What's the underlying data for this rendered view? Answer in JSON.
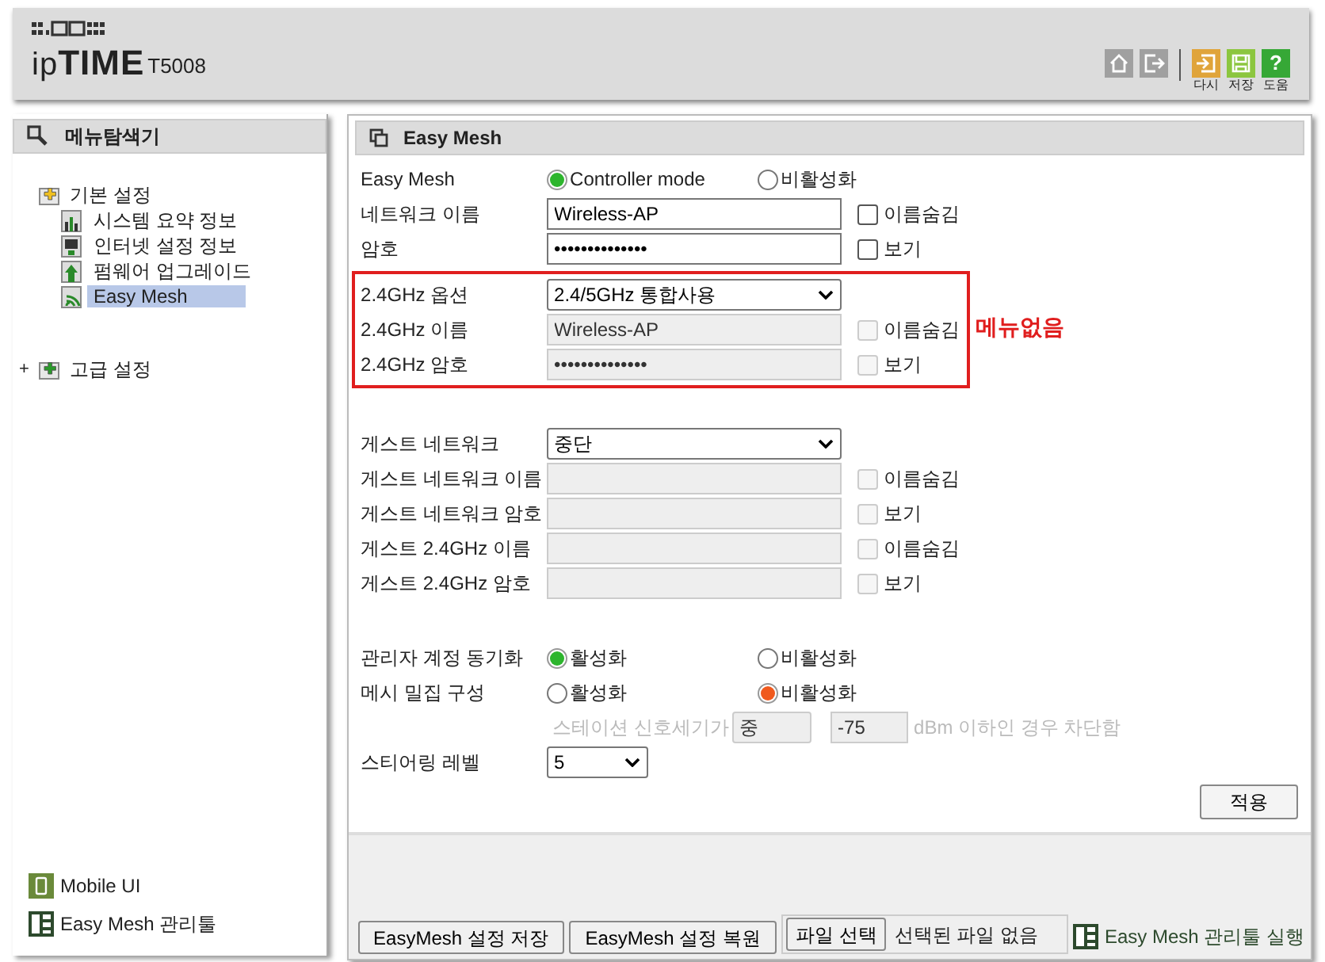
{
  "header": {
    "brand": "ip**TIME**",
    "model": "T5008",
    "tools": [
      {
        "kind": "home"
      },
      {
        "kind": "logout"
      },
      {
        "kind": "reload",
        "label": "다시"
      },
      {
        "kind": "save",
        "label": "저장"
      },
      {
        "kind": "help",
        "label": "도움",
        "glyph": "?"
      }
    ]
  },
  "sidebar": {
    "title": "메뉴탐색기",
    "tree": [
      {
        "label": "기본 설정",
        "children": [
          {
            "label": "시스템 요약 정보",
            "selected": false
          },
          {
            "label": "인터넷 설정 정보",
            "selected": false
          },
          {
            "label": "펌웨어 업그레이드",
            "selected": false
          },
          {
            "label": "Easy Mesh",
            "selected": true
          }
        ]
      },
      {
        "label": "고급 설정",
        "toggle": "+"
      }
    ],
    "links": [
      {
        "label": "Mobile UI"
      },
      {
        "label": "Easy Mesh 관리툴"
      }
    ]
  },
  "panel": {
    "title": "Easy Mesh",
    "sections": [
      {
        "rows": [
          {
            "kind": "radio",
            "label": "Easy Mesh",
            "color": "#2db52d",
            "options": [
              {
                "label": "Controller mode",
                "selected": true
              },
              {
                "label": "비활성화",
                "selected": false
              }
            ]
          },
          {
            "kind": "text",
            "label": "네트워크 이름",
            "value": "Wireless-AP",
            "disabled": false,
            "checkbox": {
              "label": "이름숨김",
              "checked": false,
              "disabled": false
            }
          },
          {
            "kind": "text",
            "label": "암호",
            "value": "••••••••••••••",
            "disabled": false,
            "checkbox": {
              "label": "보기",
              "checked": false,
              "disabled": false
            }
          }
        ]
      },
      {
        "note": "메뉴없음",
        "rows": [
          {
            "kind": "select",
            "label": "2.4GHz 옵션",
            "value": "2.4/5GHz 통합사용",
            "disabled": false
          },
          {
            "kind": "text",
            "label": "2.4GHz 이름",
            "value": "Wireless-AP",
            "disabled": true,
            "checkbox": {
              "label": "이름숨김",
              "checked": false,
              "disabled": true
            }
          },
          {
            "kind": "text",
            "label": "2.4GHz 암호",
            "value": "••••••••••••••",
            "disabled": true,
            "checkbox": {
              "label": "보기",
              "checked": false,
              "disabled": true
            }
          }
        ]
      },
      {
        "rows": [
          {
            "kind": "select",
            "label": "게스트 네트워크",
            "value": "중단",
            "disabled": false
          },
          {
            "kind": "text",
            "label": "게스트 네트워크 이름",
            "disabled": true,
            "checkbox": {
              "label": "이름숨김",
              "checked": false,
              "disabled": true
            }
          },
          {
            "kind": "text",
            "label": "게스트 네트워크 암호",
            "disabled": true,
            "checkbox": {
              "label": "보기",
              "checked": false,
              "disabled": true
            }
          },
          {
            "kind": "text",
            "label": "게스트 2.4GHz 이름",
            "disabled": true,
            "checkbox": {
              "label": "이름숨김",
              "checked": false,
              "disabled": true
            }
          },
          {
            "kind": "text",
            "label": "게스트 2.4GHz 암호",
            "disabled": true,
            "checkbox": {
              "label": "보기",
              "checked": false,
              "disabled": true
            }
          }
        ]
      },
      {
        "rows": [
          {
            "kind": "radio",
            "label": "관리자 계정 동기화",
            "color": "#2db52d",
            "options": [
              {
                "label": "활성화",
                "selected": true
              },
              {
                "label": "비활성화",
                "selected": false
              }
            ]
          },
          {
            "kind": "radio",
            "label": "메시 밀집 구성",
            "color": "#f05a1e",
            "options": [
              {
                "label": "활성화",
                "selected": false
              },
              {
                "label": "비활성화",
                "selected": true
              }
            ]
          },
          {
            "kind": "threshold",
            "disabled": true,
            "prefix": "스테이션 신호세기가",
            "level_value": "중",
            "value": "-75",
            "suffix": "dBm 이하인 경우 차단함"
          },
          {
            "kind": "level",
            "label": "스티어링 레벨",
            "value": "5",
            "disabled": false
          }
        ]
      }
    ],
    "apply": "적용",
    "footer": {
      "buttons": [
        "EasyMesh 설정 저장",
        "EasyMesh 설정 복원"
      ],
      "file_button": "파일 선택",
      "file_status": "선택된 파일 없음",
      "tool_link": "Easy Mesh 관리툴 실행"
    }
  }
}
